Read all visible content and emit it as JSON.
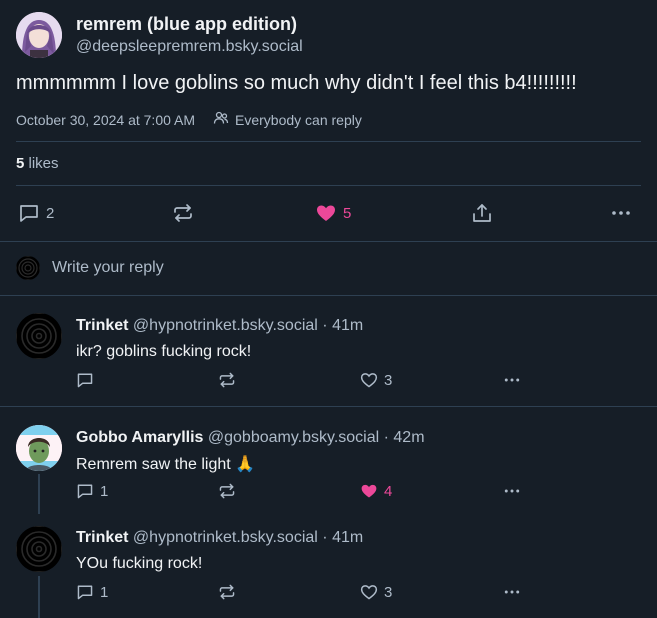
{
  "main_post": {
    "author_name": "remrem (blue app edition)",
    "author_handle": "@deepsleepremrem.bsky.social",
    "text": "mmmmmm I love goblins so much why didn't I feel this b4!!!!!!!!!",
    "timestamp": "October 30, 2024 at 7:00 AM",
    "reply_setting": "Everybody can reply",
    "likes_count": "5",
    "likes_label": "likes",
    "actions": {
      "reply_count": "2",
      "like_count": "5"
    }
  },
  "reply_composer": {
    "placeholder": "Write your reply"
  },
  "replies": [
    {
      "author_name": "Trinket",
      "author_handle": "@hypnotrinket.bsky.social",
      "separator": "·",
      "time": "41m",
      "text": "ikr? goblins fucking rock!",
      "reply_count": "",
      "like_count": "3"
    },
    {
      "author_name": "Gobbo Amaryllis",
      "author_handle": "@gobboamy.bsky.social",
      "separator": "·",
      "time": "42m",
      "text": "Remrem saw the light 🙏",
      "reply_count": "1",
      "like_count": "4"
    },
    {
      "author_name": "Trinket",
      "author_handle": "@hypnotrinket.bsky.social",
      "separator": "·",
      "time": "41m",
      "text": "YOu fucking rock!",
      "reply_count": "1",
      "like_count": "3"
    }
  ],
  "colors": {
    "background": "#161e27",
    "divider": "#2e4052",
    "muted_text": "#aebbc9",
    "like_active": "#ec4899"
  },
  "icons": {
    "reply": "speech-bubble-icon",
    "repost": "repost-arrows-icon",
    "like": "heart-icon",
    "share": "share-upload-icon",
    "more": "ellipsis-icon",
    "audience": "people-icon"
  }
}
